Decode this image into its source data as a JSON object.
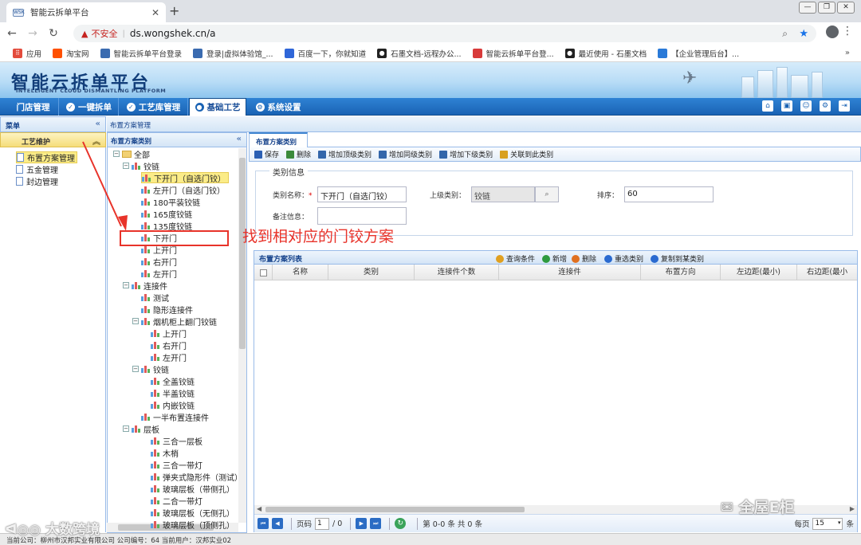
{
  "browser": {
    "tab_title": "智能云拆单平台",
    "tab_favicon": "wsk-logo",
    "security_label": "不安全",
    "url": "ds.wongshek.cn/a",
    "bookmarks": [
      {
        "label": "应用",
        "icon": "apps-grid-icon",
        "color": "#e34b3c"
      },
      {
        "label": "淘宝网",
        "icon": "taobao-icon",
        "color": "#ff5000"
      },
      {
        "label": "智能云拆单平台登录",
        "icon": "wsk-icon",
        "color": "#3a6bb0"
      },
      {
        "label": "登录|虚拟体验馆_...",
        "icon": "wsk-icon",
        "color": "#3a6bb0"
      },
      {
        "label": "百度一下，你就知道",
        "icon": "baidu-paw-icon",
        "color": "#2f66d8"
      },
      {
        "label": "石墨文档-远程办公...",
        "icon": "shimo-icon",
        "color": "#222222"
      },
      {
        "label": "智能云拆单平台登...",
        "icon": "wsk-red-icon",
        "color": "#d83a3a"
      },
      {
        "label": "最近使用 - 石墨文档",
        "icon": "shimo-icon",
        "color": "#222222"
      },
      {
        "label": "【企业管理后台】...",
        "icon": "shield-icon",
        "color": "#2a7ad8"
      }
    ]
  },
  "app": {
    "logo_cn": "智能云拆单平台",
    "logo_en": "INTELLIGENT CLOUD DISMANTLING PLATFORM",
    "nav": [
      {
        "label": "门店管理"
      },
      {
        "label": "一键拆单"
      },
      {
        "label": "工艺库管理"
      },
      {
        "label": "基础工艺"
      },
      {
        "label": "系统设置"
      }
    ],
    "active_nav": "基础工艺",
    "header_icons": [
      "home-icon",
      "monitor-icon",
      "user-icon",
      "gear-icon",
      "exit-icon"
    ]
  },
  "left_menu": {
    "title": "菜单",
    "group": "工艺维护",
    "items": [
      "布置方案管理",
      "五金管理",
      "封边管理"
    ],
    "selected": "布置方案管理"
  },
  "breadcrumb": "布置方案管理",
  "tree": {
    "title": "布置方案类别",
    "nodes": [
      {
        "label": "全部",
        "level": 0,
        "type": "folder",
        "expanded": true
      },
      {
        "label": "铰链",
        "level": 1,
        "type": "group",
        "expanded": true
      },
      {
        "label": "下开门（自选门铰）",
        "level": 2,
        "type": "leaf",
        "selected": true
      },
      {
        "label": "左开门（自选门铰）",
        "level": 2,
        "type": "leaf"
      },
      {
        "label": "180平装铰链",
        "level": 2,
        "type": "leaf"
      },
      {
        "label": "165度铰链",
        "level": 2,
        "type": "leaf"
      },
      {
        "label": "135度铰链",
        "level": 2,
        "type": "leaf"
      },
      {
        "label": "下开门",
        "level": 2,
        "type": "leaf"
      },
      {
        "label": "上开门",
        "level": 2,
        "type": "leaf"
      },
      {
        "label": "右开门",
        "level": 2,
        "type": "leaf"
      },
      {
        "label": "左开门",
        "level": 2,
        "type": "leaf"
      },
      {
        "label": "连接件",
        "level": 1,
        "type": "group",
        "expanded": true
      },
      {
        "label": "测试",
        "level": 2,
        "type": "leaf"
      },
      {
        "label": "隐形连接件",
        "level": 2,
        "type": "leaf"
      },
      {
        "label": "烟机柜上翻门铰链",
        "level": 2,
        "type": "group",
        "expanded": true
      },
      {
        "label": "上开门",
        "level": 3,
        "type": "leaf"
      },
      {
        "label": "右开门",
        "level": 3,
        "type": "leaf"
      },
      {
        "label": "左开门",
        "level": 3,
        "type": "leaf"
      },
      {
        "label": "铰链",
        "level": 2,
        "type": "group",
        "expanded": true
      },
      {
        "label": "全盖铰链",
        "level": 3,
        "type": "leaf"
      },
      {
        "label": "半盖铰链",
        "level": 3,
        "type": "leaf"
      },
      {
        "label": "内嵌铰链",
        "level": 3,
        "type": "leaf"
      },
      {
        "label": "一半布置连接件",
        "level": 2,
        "type": "leaf"
      },
      {
        "label": "层板",
        "level": 1,
        "type": "group",
        "expanded": true
      },
      {
        "label": "三合一层板",
        "level": 3,
        "type": "leaf"
      },
      {
        "label": "木梢",
        "level": 3,
        "type": "leaf"
      },
      {
        "label": "三合一带灯",
        "level": 3,
        "type": "leaf"
      },
      {
        "label": "弹夹式隐形件（测试）",
        "level": 3,
        "type": "leaf"
      },
      {
        "label": "玻璃层板（带侧孔）",
        "level": 3,
        "type": "leaf"
      },
      {
        "label": "二合一带灯",
        "level": 3,
        "type": "leaf"
      },
      {
        "label": "玻璃层板（无侧孔）",
        "level": 3,
        "type": "leaf"
      },
      {
        "label": "玻璃层板（顶侧孔）",
        "level": 3,
        "type": "leaf"
      }
    ]
  },
  "content_tab": "布置方案类别",
  "toolbar": [
    {
      "label": "保存",
      "icon": "save-icon",
      "color": "#2b5fb3"
    },
    {
      "label": "删除",
      "icon": "trash-icon",
      "color": "#3b8a3b"
    },
    {
      "label": "增加顶级类别",
      "icon": "add-top-category-icon",
      "color": "#3366aa"
    },
    {
      "label": "增加同级类别",
      "icon": "add-sibling-category-icon",
      "color": "#3366aa"
    },
    {
      "label": "增加下级类别",
      "icon": "add-child-category-icon",
      "color": "#3366aa"
    },
    {
      "label": "关联到此类别",
      "icon": "link-folder-icon",
      "color": "#d8a020"
    }
  ],
  "form": {
    "legend": "类别信息",
    "name_label": "类别名称：",
    "name_value": "下开门（自选门铰）",
    "parent_label": "上级类别：",
    "parent_value": "铰链",
    "order_label": "排序：",
    "order_value": "60",
    "note_label": "备注信息：",
    "note_value": ""
  },
  "grid": {
    "title": "布置方案列表",
    "actions": [
      {
        "label": "查询条件",
        "icon": "query-icon",
        "color": "#e0a020"
      },
      {
        "label": "新增",
        "icon": "add-icon",
        "color": "#2e9a3e"
      },
      {
        "label": "删除",
        "icon": "delete-icon",
        "color": "#e07020"
      },
      {
        "label": "重选类别",
        "icon": "reselect-icon",
        "color": "#2a6ad0"
      },
      {
        "label": "复制到某类别",
        "icon": "copy-icon",
        "color": "#2a6ad0"
      }
    ],
    "columns": [
      "名称",
      "类别",
      "连接件个数",
      "连接件",
      "布置方向",
      "左边距(最小)",
      "右边距(最小"
    ],
    "rows": []
  },
  "pager": {
    "page_label": "页码",
    "page_value": "1",
    "total_pages": "/ 0",
    "summary": "第 0-0 条  共 0 条",
    "per_page_label": "每页",
    "per_page_value": "15",
    "unit": "条"
  },
  "status": "当前公司：柳州市汉邦实业有限公司    公司编号：64    当前用户：汉邦实业02",
  "annotation": "找到相对应的门铰方案",
  "watermarks": [
    "大数跨境",
    "全屋E柜"
  ]
}
